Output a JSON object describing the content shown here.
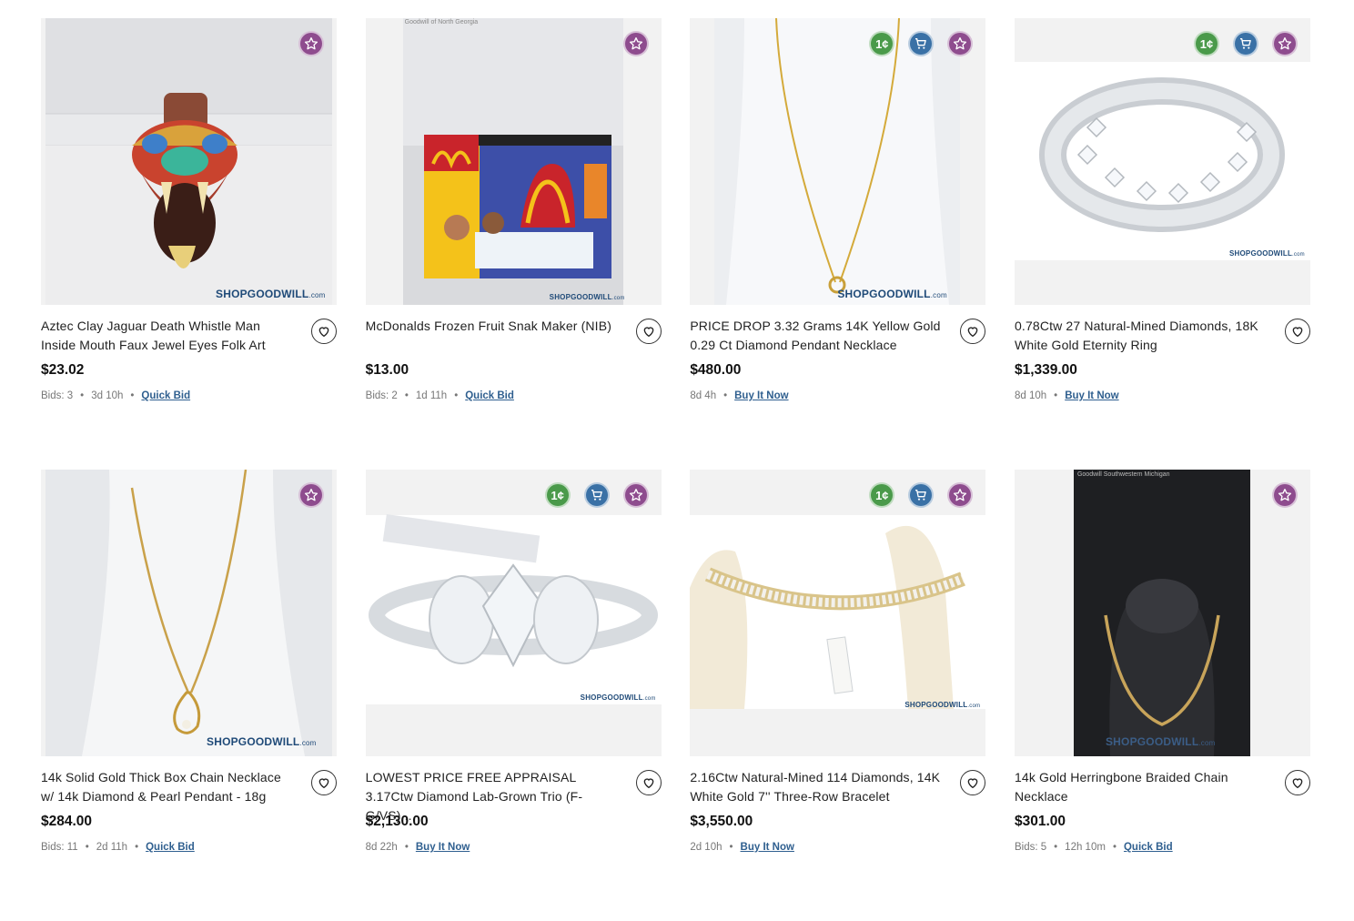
{
  "colors": {
    "favorite_badge": "#8e4c8e",
    "cart_badge": "#3a71a6",
    "penny_badge": "#4a9a4a",
    "link": "#2f5f8f"
  },
  "watermark": "SHOPGOODWILL",
  "watermark_suffix": ".com",
  "items": [
    {
      "title": "Aztec Clay Jaguar Death Whistle Man Inside Mouth Faux Jewel Eyes Folk Art",
      "price": "$23.02",
      "bids": "Bids: 3",
      "time": "3d 10h",
      "action": "Quick Bid",
      "badges": [
        "favorite"
      ],
      "image_caption": ""
    },
    {
      "title": "McDonalds Frozen Fruit Snak Maker (NIB)",
      "price": "$13.00",
      "bids": "Bids: 2",
      "time": "1d 11h",
      "action": "Quick Bid",
      "badges": [
        "favorite"
      ],
      "image_caption": "Goodwill of North Georgia"
    },
    {
      "title": "PRICE DROP 3.32 Grams 14K Yellow Gold 0.29 Ct Diamond Pendant Necklace",
      "price": "$480.00",
      "bids": "",
      "time": "8d 4h",
      "action": "Buy It Now",
      "badges": [
        "penny",
        "cart",
        "favorite"
      ],
      "image_caption": ""
    },
    {
      "title": "0.78Ctw 27 Natural-Mined Diamonds, 18K White Gold Eternity Ring",
      "price": "$1,339.00",
      "bids": "",
      "time": "8d 10h",
      "action": "Buy It Now",
      "badges": [
        "penny",
        "cart",
        "favorite"
      ],
      "image_caption": ""
    },
    {
      "title": "14k Solid Gold Thick Box Chain Necklace w/ 14k Diamond & Pearl Pendant - 18g",
      "price": "$284.00",
      "bids": "Bids: 11",
      "time": "2d 11h",
      "action": "Quick Bid",
      "badges": [
        "favorite"
      ],
      "image_caption": ""
    },
    {
      "title": "LOWEST PRICE FREE APPRAISAL 3.17Ctw Diamond Lab-Grown Trio (F-G/VS)...",
      "price": "$2,130.00",
      "bids": "",
      "time": "8d 22h",
      "action": "Buy It Now",
      "badges": [
        "penny",
        "cart",
        "favorite"
      ],
      "image_caption": ""
    },
    {
      "title": "2.16Ctw Natural-Mined 114 Diamonds, 14K White Gold 7'' Three-Row Bracelet",
      "price": "$3,550.00",
      "bids": "",
      "time": "2d 10h",
      "action": "Buy It Now",
      "badges": [
        "penny",
        "cart",
        "favorite"
      ],
      "image_caption": ""
    },
    {
      "title": "14k Gold Herringbone Braided Chain Necklace",
      "price": "$301.00",
      "bids": "Bids: 5",
      "time": "12h 10m",
      "action": "Quick Bid",
      "badges": [
        "favorite"
      ],
      "image_caption": "Goodwill Southwestern Michigan"
    }
  ]
}
